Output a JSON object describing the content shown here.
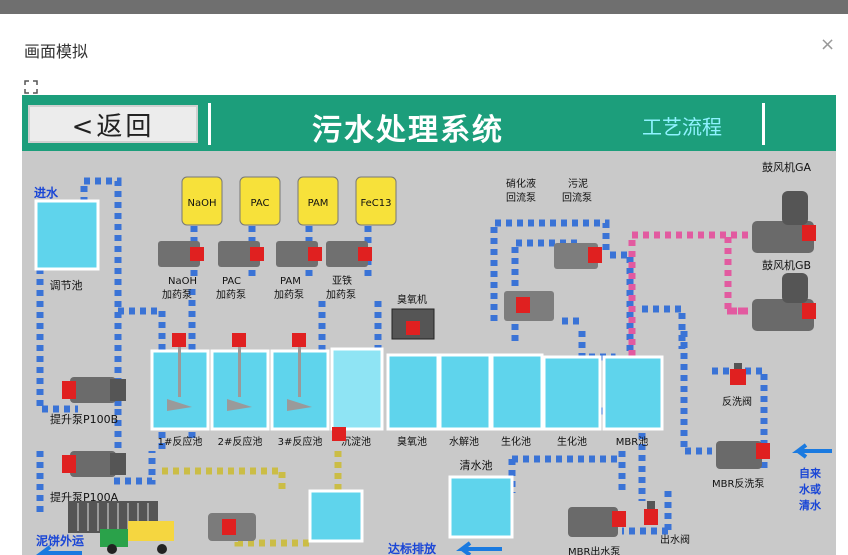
{
  "dialog": {
    "title": "画面模拟",
    "close": "×"
  },
  "header": {
    "back": "<返回",
    "title": "污水处理系统",
    "process": "工艺流程"
  },
  "labels": {
    "inlet": "进水",
    "adjust_tank": "调节池",
    "lift_b": "提升泵P100B",
    "lift_a": "提升泵P100A",
    "cake": "泥饼外运",
    "naoh_tag": "NaOH",
    "pac_tag": "PAC",
    "pam_tag": "PAM",
    "fecl_tag": "FeC13",
    "naoh_pump": [
      "NaOH",
      "加药泵"
    ],
    "pac_pump": [
      "PAC",
      "加药泵"
    ],
    "pam_pump": [
      "PAM",
      "加药泵"
    ],
    "fe_pump": [
      "亚铁",
      "加药泵"
    ],
    "ozone_machine": "臭氧机",
    "nitrate": [
      "硝化液",
      "回流泵"
    ],
    "sludge": [
      "污泥",
      "回流泵"
    ],
    "blower_ga": "鼓风机GA",
    "blower_gb": "鼓风机GB",
    "r1": "1#反应池",
    "r2": "2#反应池",
    "r3": "3#反应池",
    "settle": "沉淀池",
    "ozone_tank": "臭氧池",
    "hydro": "水解池",
    "bio1": "生化池",
    "bio2": "生化池",
    "mbr": "MBR池",
    "backwash_valve": "反洗阀",
    "mbr_backwash": "MBR反洗泵",
    "source": [
      "自来",
      "水或",
      "清水"
    ],
    "clean_tank": "清水池",
    "mbr_out": "MBR出水泵",
    "out_valve": "出水阀",
    "discharge": "达标排放"
  }
}
